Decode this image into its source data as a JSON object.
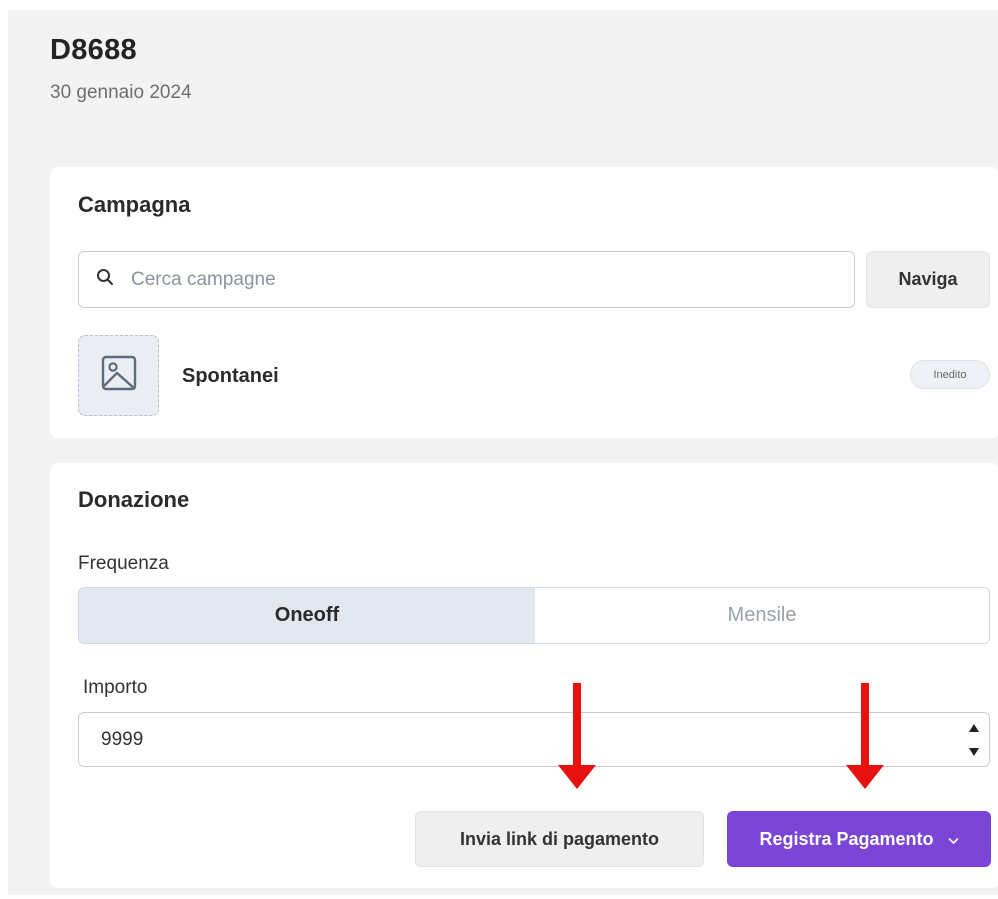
{
  "header": {
    "title": "D8688",
    "date": "30 gennaio 2024"
  },
  "campaign_card": {
    "title": "Campagna",
    "search_placeholder": "Cerca campagne",
    "search_value": "",
    "browse_label": "Naviga",
    "selected_campaign": {
      "name": "Spontanei",
      "status": "Inedito",
      "image_icon": "image-icon"
    }
  },
  "donation_card": {
    "title": "Donazione",
    "frequency_label": "Frequenza",
    "frequency_options": [
      "Oneoff",
      "Mensile"
    ],
    "frequency_selected": "Oneoff",
    "amount_label": "Importo",
    "amount_value": "9999",
    "send_link_label": "Invia link di pagamento",
    "register_label": "Registra Pagamento",
    "register_icon": "chevron-down-icon"
  },
  "annotations": {
    "arrow_color": "#e8110d"
  },
  "colors": {
    "accent": "#7a45d6",
    "page_background": "#f3f3f3",
    "segment_active": "#e3e8f0"
  }
}
